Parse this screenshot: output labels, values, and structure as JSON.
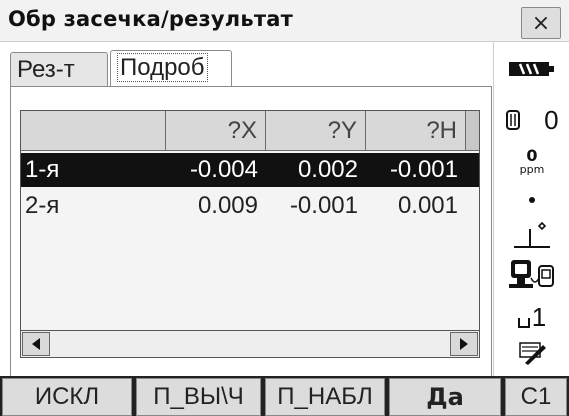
{
  "window": {
    "title": "Обр засечка/результат",
    "close_label": "×"
  },
  "tabs": [
    {
      "label": "Рез-т",
      "active": false
    },
    {
      "label": "Подроб",
      "active": true
    }
  ],
  "table": {
    "headers": [
      "",
      "?X",
      "?Y",
      "?H"
    ],
    "rows": [
      {
        "id": "1-я",
        "x": "-0.004",
        "y": "0.002",
        "h": "-0.001",
        "selected": true
      },
      {
        "id": "2-я",
        "x": "0.009",
        "y": "-0.001",
        "h": "0.001",
        "selected": false
      }
    ]
  },
  "status_bar": {
    "battery_icon": "battery-icon",
    "prism_constant": "0",
    "ppm_value": "0",
    "ppm_unit": "ppm",
    "laser_dot_icon": "dot-icon",
    "tilt_icon": "tilt-icon",
    "interface_icon": "instrument-icon",
    "reflector_value": "1",
    "pen_icon": "pen-icon"
  },
  "softkeys": {
    "k1": "ИСКЛ",
    "k2": "П_ВЫ\\Ч",
    "k3": "П_НАБЛ",
    "k4": "Да",
    "k5": "С1"
  }
}
